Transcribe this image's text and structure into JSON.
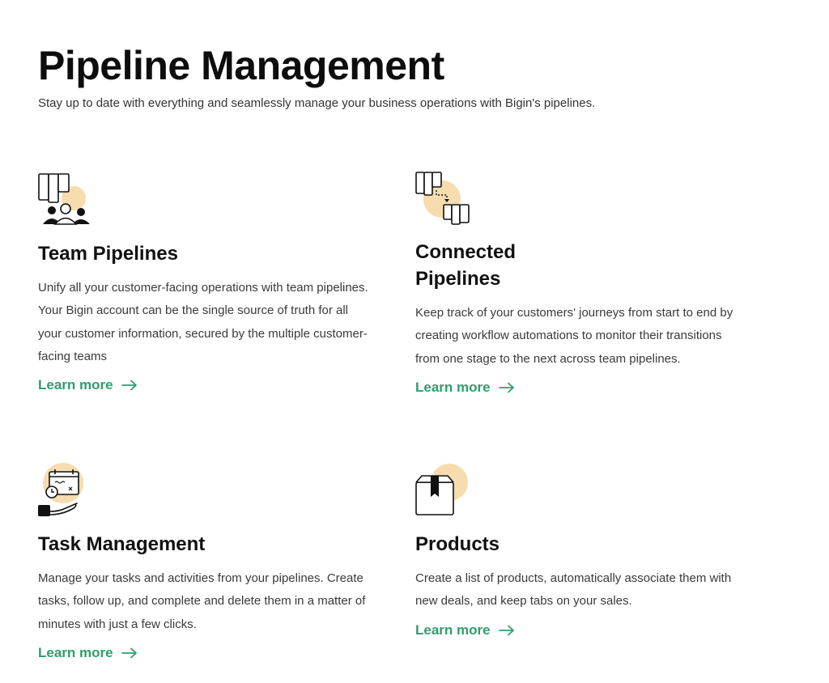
{
  "header": {
    "title": "Pipeline Management",
    "subtitle": "Stay up to date with everything and seamlessly manage your business operations with Bigin's pipelines."
  },
  "features": [
    {
      "icon": "team-pipelines-icon",
      "title": "Team Pipelines",
      "description": "Unify all your customer-facing operations with team pipelines. Your Bigin account can be the single source of truth for all your customer information, secured by the multiple customer-facing teams",
      "link": "Learn more"
    },
    {
      "icon": "connected-pipelines-icon",
      "title": "Connected Pipelines",
      "description": "Keep track of your customers' journeys from start to end by creating workflow automations to monitor their transitions from one stage to the next across team pipelines.",
      "link": "Learn more"
    },
    {
      "icon": "task-management-icon",
      "title": "Task Management",
      "description": "Manage your tasks and activities from your pipelines. Create tasks, follow up, and complete and delete them in a matter of minutes with just a few clicks.",
      "link": "Learn more"
    },
    {
      "icon": "products-icon",
      "title": "Products",
      "description": "Create a list of products, automatically associate them with new deals, and keep tabs on your sales.",
      "link": "Learn more"
    }
  ],
  "colors": {
    "accent": "#2e9e6c",
    "icon_blob": "#f6dcae",
    "text": "#111111"
  }
}
